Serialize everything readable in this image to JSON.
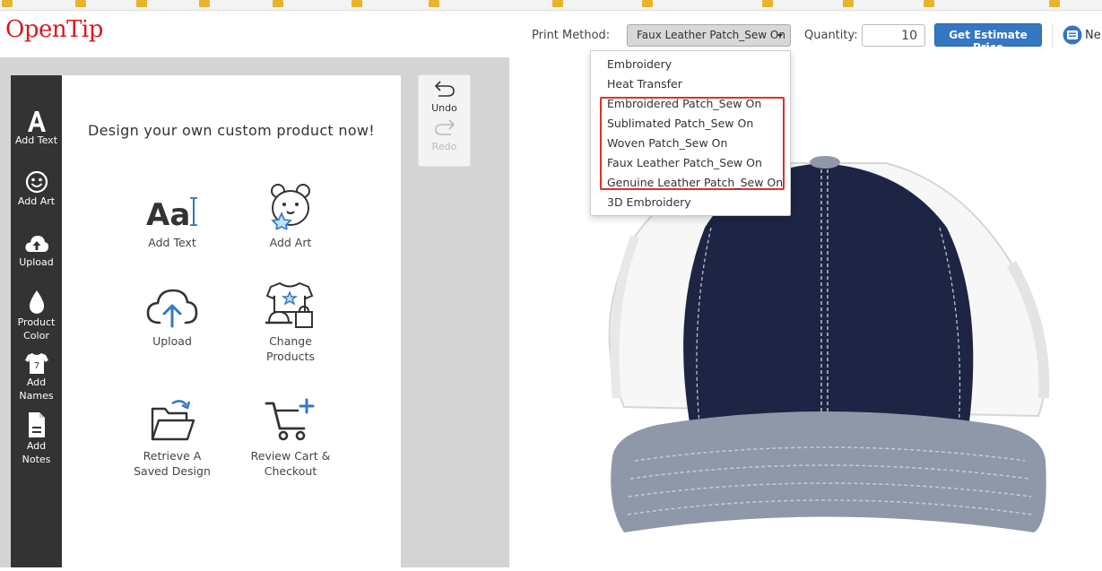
{
  "logo": "OpenTip",
  "topbar": {
    "print_method_label": "Print Method:",
    "print_method_value": "Faux Leather Patch_Sew On",
    "quantity_label": "Quantity:",
    "quantity_value": "10",
    "estimate_button": "Get Estimate Price",
    "ne_text": "Ne"
  },
  "sidebar": {
    "items": [
      {
        "label": "Add Text",
        "icon": "letter-a-icon"
      },
      {
        "label": "Add Art",
        "icon": "smiley-icon"
      },
      {
        "label": "Upload",
        "icon": "cloud-upload-icon"
      },
      {
        "label": "Product Color",
        "icon": "drop-icon"
      },
      {
        "label": "Add Names",
        "icon": "jersey-icon"
      },
      {
        "label": "Add Notes",
        "icon": "note-icon"
      }
    ]
  },
  "panel": {
    "title": "Design your own custom product now!",
    "tools": [
      {
        "label": "Add Text",
        "icon": "text-aa-icon"
      },
      {
        "label": "Add Art",
        "icon": "art-icon"
      },
      {
        "label": "Upload",
        "icon": "cloud-upload-icon"
      },
      {
        "label": "Change Products",
        "icon": "products-icon"
      },
      {
        "label": "Retrieve A Saved Design",
        "icon": "folder-icon"
      },
      {
        "label": "Review Cart & Checkout",
        "icon": "cart-icon"
      }
    ]
  },
  "history": {
    "undo": "Undo",
    "redo": "Redo"
  },
  "dropdown": {
    "options": [
      "Embroidery",
      "Heat Transfer",
      "Embroidered Patch_Sew On",
      "Sublimated Patch_Sew On",
      "Woven Patch_Sew On",
      "Faux Leather Patch_Sew On",
      "Genuine Leather Patch_Sew On",
      "3D Embroidery"
    ]
  },
  "colors": {
    "brand": "#d71920",
    "accent_button": "#3577c3",
    "sidebar": "#333333",
    "highlight_box": "#e0302a",
    "hat_crown": "#1e2444",
    "hat_mesh": "#ffffff",
    "hat_brim": "#8f98a8"
  }
}
